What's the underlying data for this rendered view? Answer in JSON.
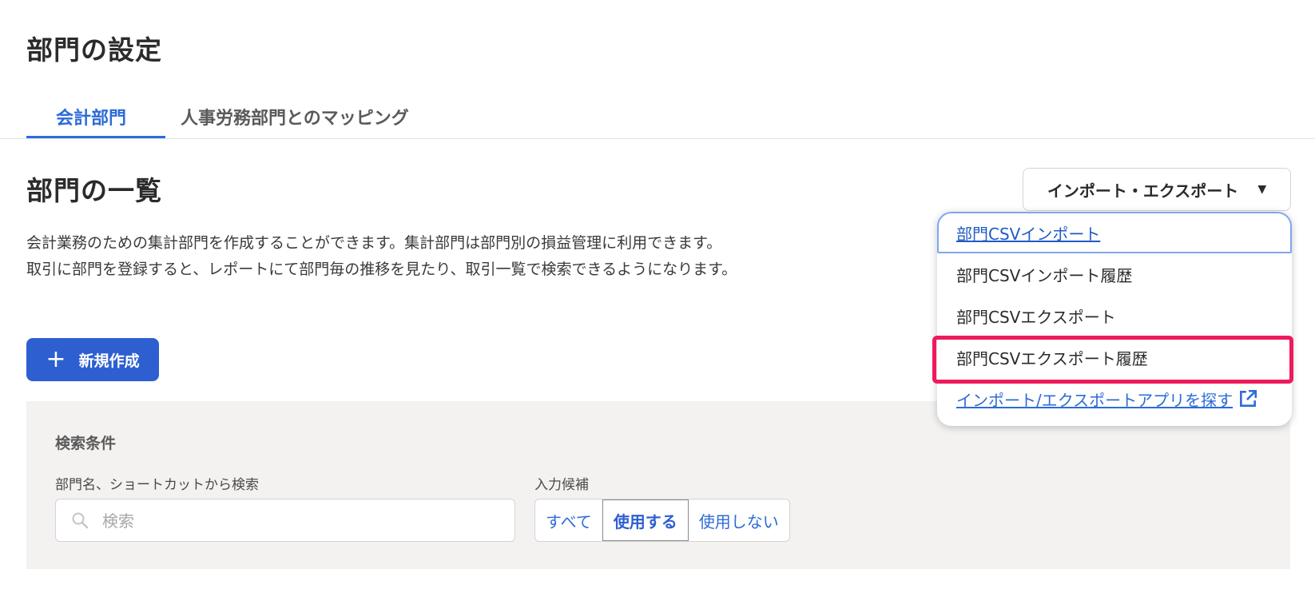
{
  "page": {
    "title": "部門の設定"
  },
  "tabs": [
    {
      "label": "会計部門",
      "active": true
    },
    {
      "label": "人事労務部門とのマッピング",
      "active": false
    }
  ],
  "section": {
    "title": "部門の一覧",
    "description_line1": "会計業務のための集計部門を作成することができます。集計部門は部門別の損益管理に利用できます。",
    "description_line2": "取引に部門を登録すると、レポートにて部門毎の推移を見たり、取引一覧で検索できるようになります。"
  },
  "new_button": {
    "label": "新規作成",
    "icon": "plus-icon"
  },
  "import_export": {
    "label": "インポート・エクスポート",
    "menu": [
      "部門CSVインポート",
      "部門CSVインポート履歴",
      "部門CSVエクスポート",
      "部門CSVエクスポート履歴",
      "インポート/エクスポートアプリを探す"
    ],
    "highlighted_item": "部門CSVエクスポート履歴"
  },
  "search": {
    "heading": "検索条件",
    "name_label": "部門名、ショートカットから検索",
    "placeholder": "検索",
    "candidates_label": "入力候補",
    "candidates": [
      "すべて",
      "使用する",
      "使用しない"
    ],
    "selected_candidate": "使用する"
  },
  "colors": {
    "accent": "#2d6bd8",
    "primary_button": "#2d5fd0",
    "highlight_border": "#ee1a5c",
    "panel_bg": "#f4f2f1"
  }
}
